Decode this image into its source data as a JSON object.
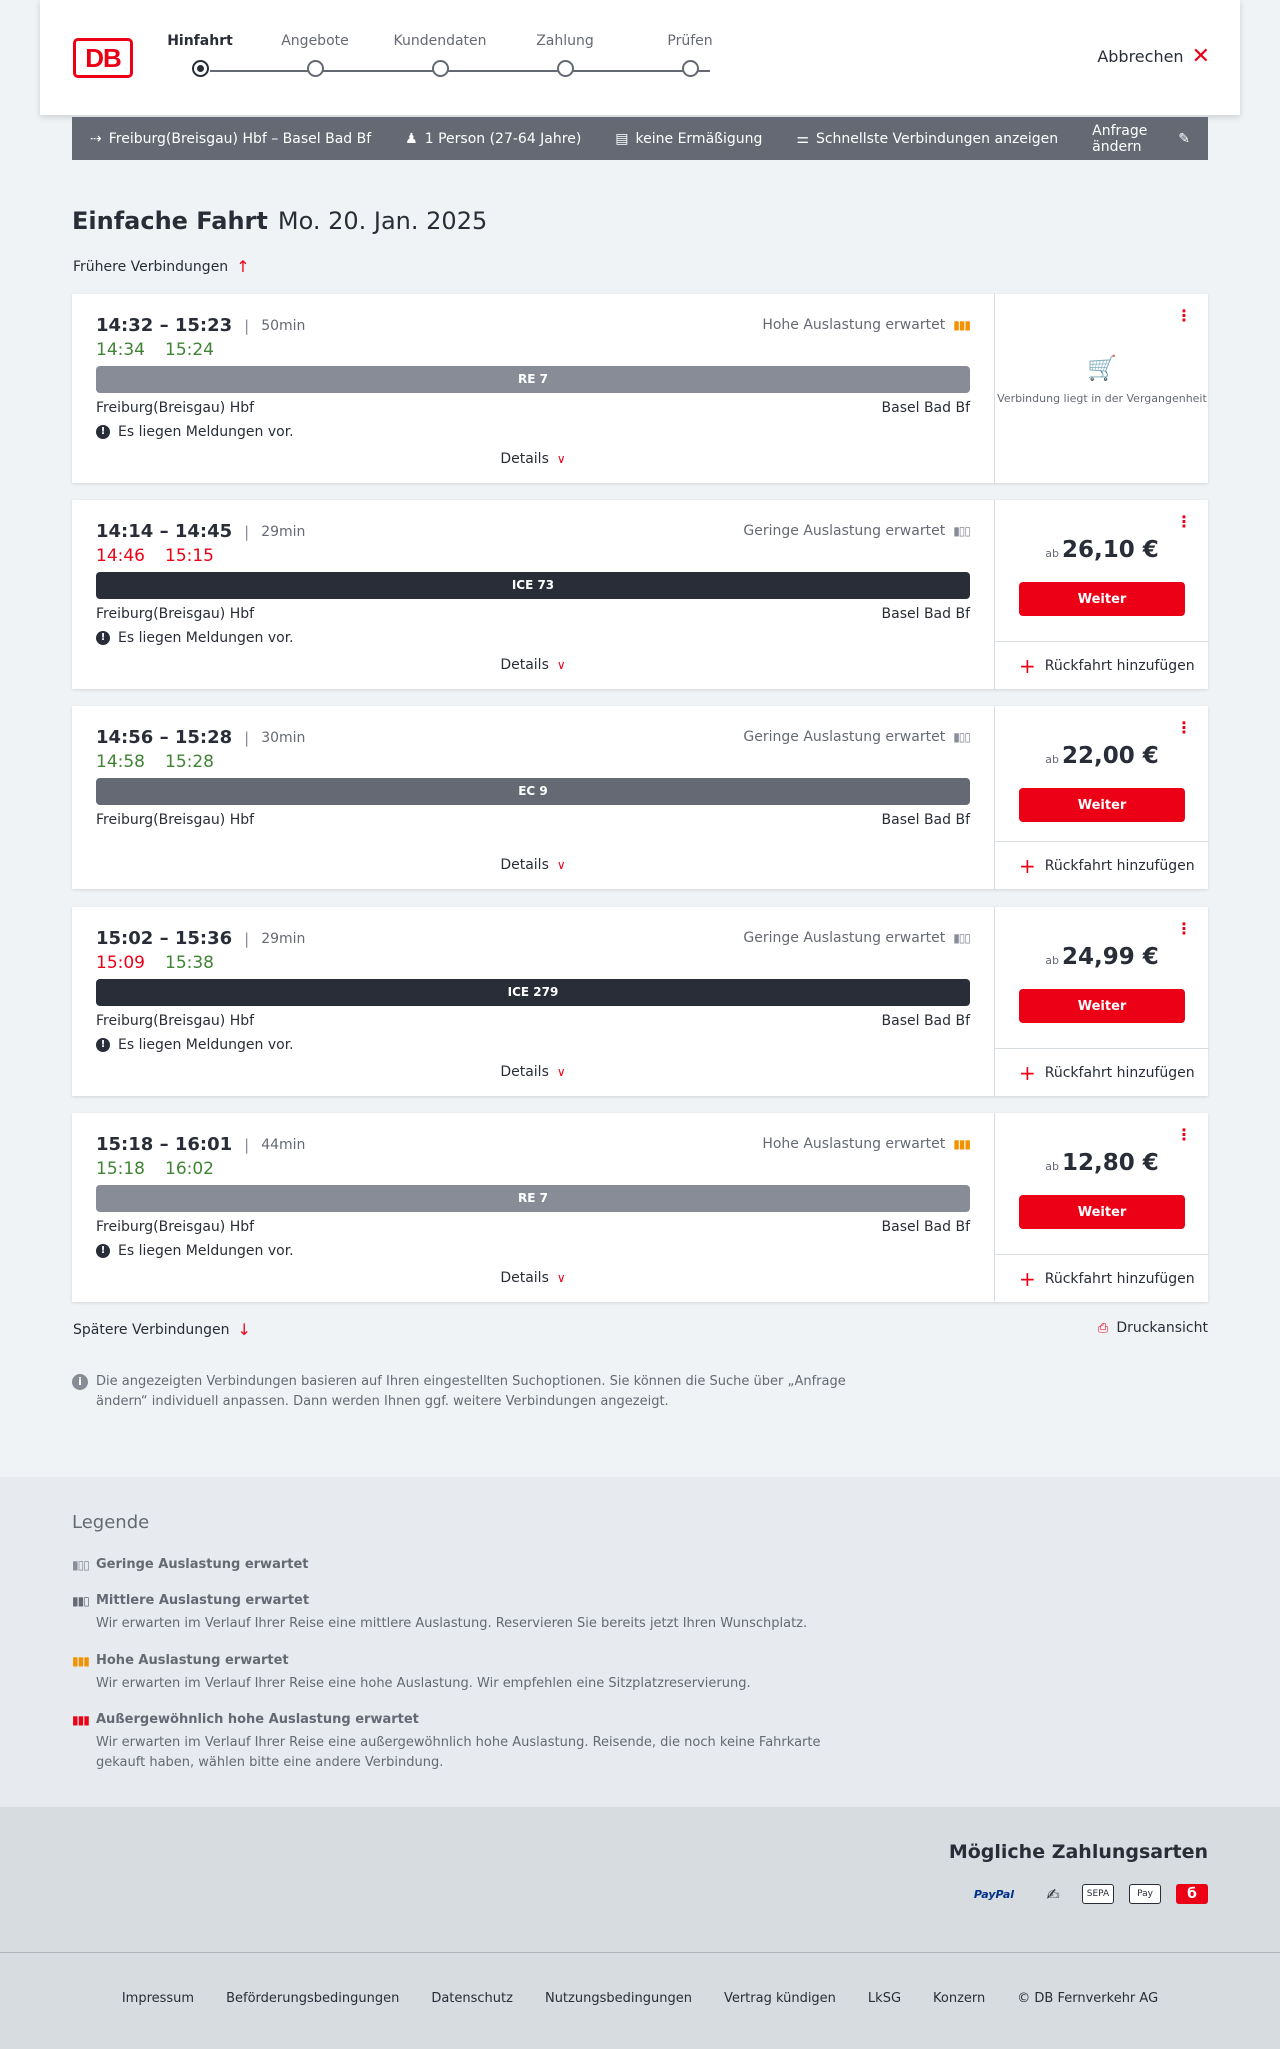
{
  "header": {
    "logo": "DB",
    "steps": [
      "Hinfahrt",
      "Angebote",
      "Kundendaten",
      "Zahlung",
      "Prüfen"
    ],
    "active_step": "Hinfahrt",
    "cancel_label": "Abbrechen"
  },
  "query": {
    "route": "Freiburg(Breisgau) Hbf – Basel Bad Bf",
    "passengers": "1 Person (27-64 Jahre)",
    "discount": "keine Ermäßigung",
    "filter": "Schnellste Verbindungen anzeigen",
    "change": "Anfrage ändern"
  },
  "title": {
    "type": "Einfache Fahrt",
    "date": "Mo. 20. Jan. 2025"
  },
  "earlier_label": "Frühere Verbindungen",
  "later_label": "Spätere Verbindungen",
  "print_label": "Druckansicht",
  "details_label": "Details",
  "weiter_label": "Weiter",
  "return_label": "Rückfahrt hinzufügen",
  "price_prefix": "ab",
  "messages_label": "Es liegen Meldungen vor.",
  "past_label": "Verbindung liegt in der Vergangenheit",
  "connections": [
    {
      "times": "14:32 – 15:23",
      "duration": "50min",
      "rt_dep": "14:34",
      "rt_arr": "15:24",
      "rt_dep_late": false,
      "rt_arr_late": false,
      "occupancy": "Hohe Auslastung erwartet",
      "occupancy_level": "high",
      "train": "RE 7",
      "train_type": "re",
      "from": "Freiburg(Breisgau) Hbf",
      "to": "Basel Bad Bf",
      "has_messages": true,
      "past": true
    },
    {
      "times": "14:14 – 14:45",
      "duration": "29min",
      "rt_dep": "14:46",
      "rt_arr": "15:15",
      "rt_dep_late": true,
      "rt_arr_late": true,
      "occupancy": "Geringe Auslastung erwartet",
      "occupancy_level": "low",
      "train": "ICE 73",
      "train_type": "ice",
      "from": "Freiburg(Breisgau) Hbf",
      "to": "Basel Bad Bf",
      "has_messages": true,
      "price": "26,10 €"
    },
    {
      "times": "14:56 – 15:28",
      "duration": "30min",
      "rt_dep": "14:58",
      "rt_arr": "15:28",
      "rt_dep_late": false,
      "rt_arr_late": false,
      "occupancy": "Geringe Auslastung erwartet",
      "occupancy_level": "low",
      "train": "EC 9",
      "train_type": "ec",
      "from": "Freiburg(Breisgau) Hbf",
      "to": "Basel Bad Bf",
      "has_messages": false,
      "price": "22,00 €"
    },
    {
      "times": "15:02 – 15:36",
      "duration": "29min",
      "rt_dep": "15:09",
      "rt_arr": "15:38",
      "rt_dep_late": true,
      "rt_arr_late": false,
      "occupancy": "Geringe Auslastung erwartet",
      "occupancy_level": "low",
      "train": "ICE 279",
      "train_type": "ice",
      "from": "Freiburg(Breisgau) Hbf",
      "to": "Basel Bad Bf",
      "has_messages": true,
      "price": "24,99 €"
    },
    {
      "times": "15:18 – 16:01",
      "duration": "44min",
      "rt_dep": "15:18",
      "rt_arr": "16:02",
      "rt_dep_late": false,
      "rt_arr_late": false,
      "occupancy": "Hohe Auslastung erwartet",
      "occupancy_level": "high",
      "train": "RE 7",
      "train_type": "re",
      "from": "Freiburg(Breisgau) Hbf",
      "to": "Basel Bad Bf",
      "has_messages": true,
      "price": "12,80 €"
    }
  ],
  "info_text": "Die angezeigten Verbindungen basieren auf Ihren eingestellten Suchoptionen. Sie können die Suche über „Anfrage ändern“ individuell anpassen. Dann werden Ihnen ggf. weitere Verbindungen angezeigt.",
  "legend": {
    "title": "Legende",
    "items": [
      {
        "title": "Geringe Auslastung erwartet",
        "desc": ""
      },
      {
        "title": "Mittlere Auslastung erwartet",
        "desc": "Wir erwarten im Verlauf Ihrer Reise eine mittlere Auslastung. Reservieren Sie bereits jetzt Ihren Wunschplatz."
      },
      {
        "title": "Hohe Auslastung erwartet",
        "desc": "Wir erwarten im Verlauf Ihrer Reise eine hohe Auslastung. Wir empfehlen eine Sitzplatzreservierung."
      },
      {
        "title": "Außergewöhnlich hohe Auslastung erwartet",
        "desc": "Wir erwarten im Verlauf Ihrer Reise eine außergewöhnlich hohe Auslastung. Reisende, die noch keine Fahrkarte gekauft haben, wählen bitte eine andere Verbindung."
      }
    ]
  },
  "payment": {
    "title": "Mögliche Zahlungsarten",
    "paypal": "PayPal",
    "sepa": "SEPA",
    "applepay": "Pay"
  },
  "footer": {
    "links": [
      "Impressum",
      "Beförderungsbedingungen",
      "Datenschutz",
      "Nutzungsbedingungen",
      "Vertrag kündigen",
      "LkSG",
      "Konzern",
      "© DB Fernverkehr AG"
    ]
  },
  "colors": {
    "brand_red": "#ec0016",
    "on_time": "#408335",
    "high_occupancy": "#f39200",
    "dark": "#282d37"
  }
}
